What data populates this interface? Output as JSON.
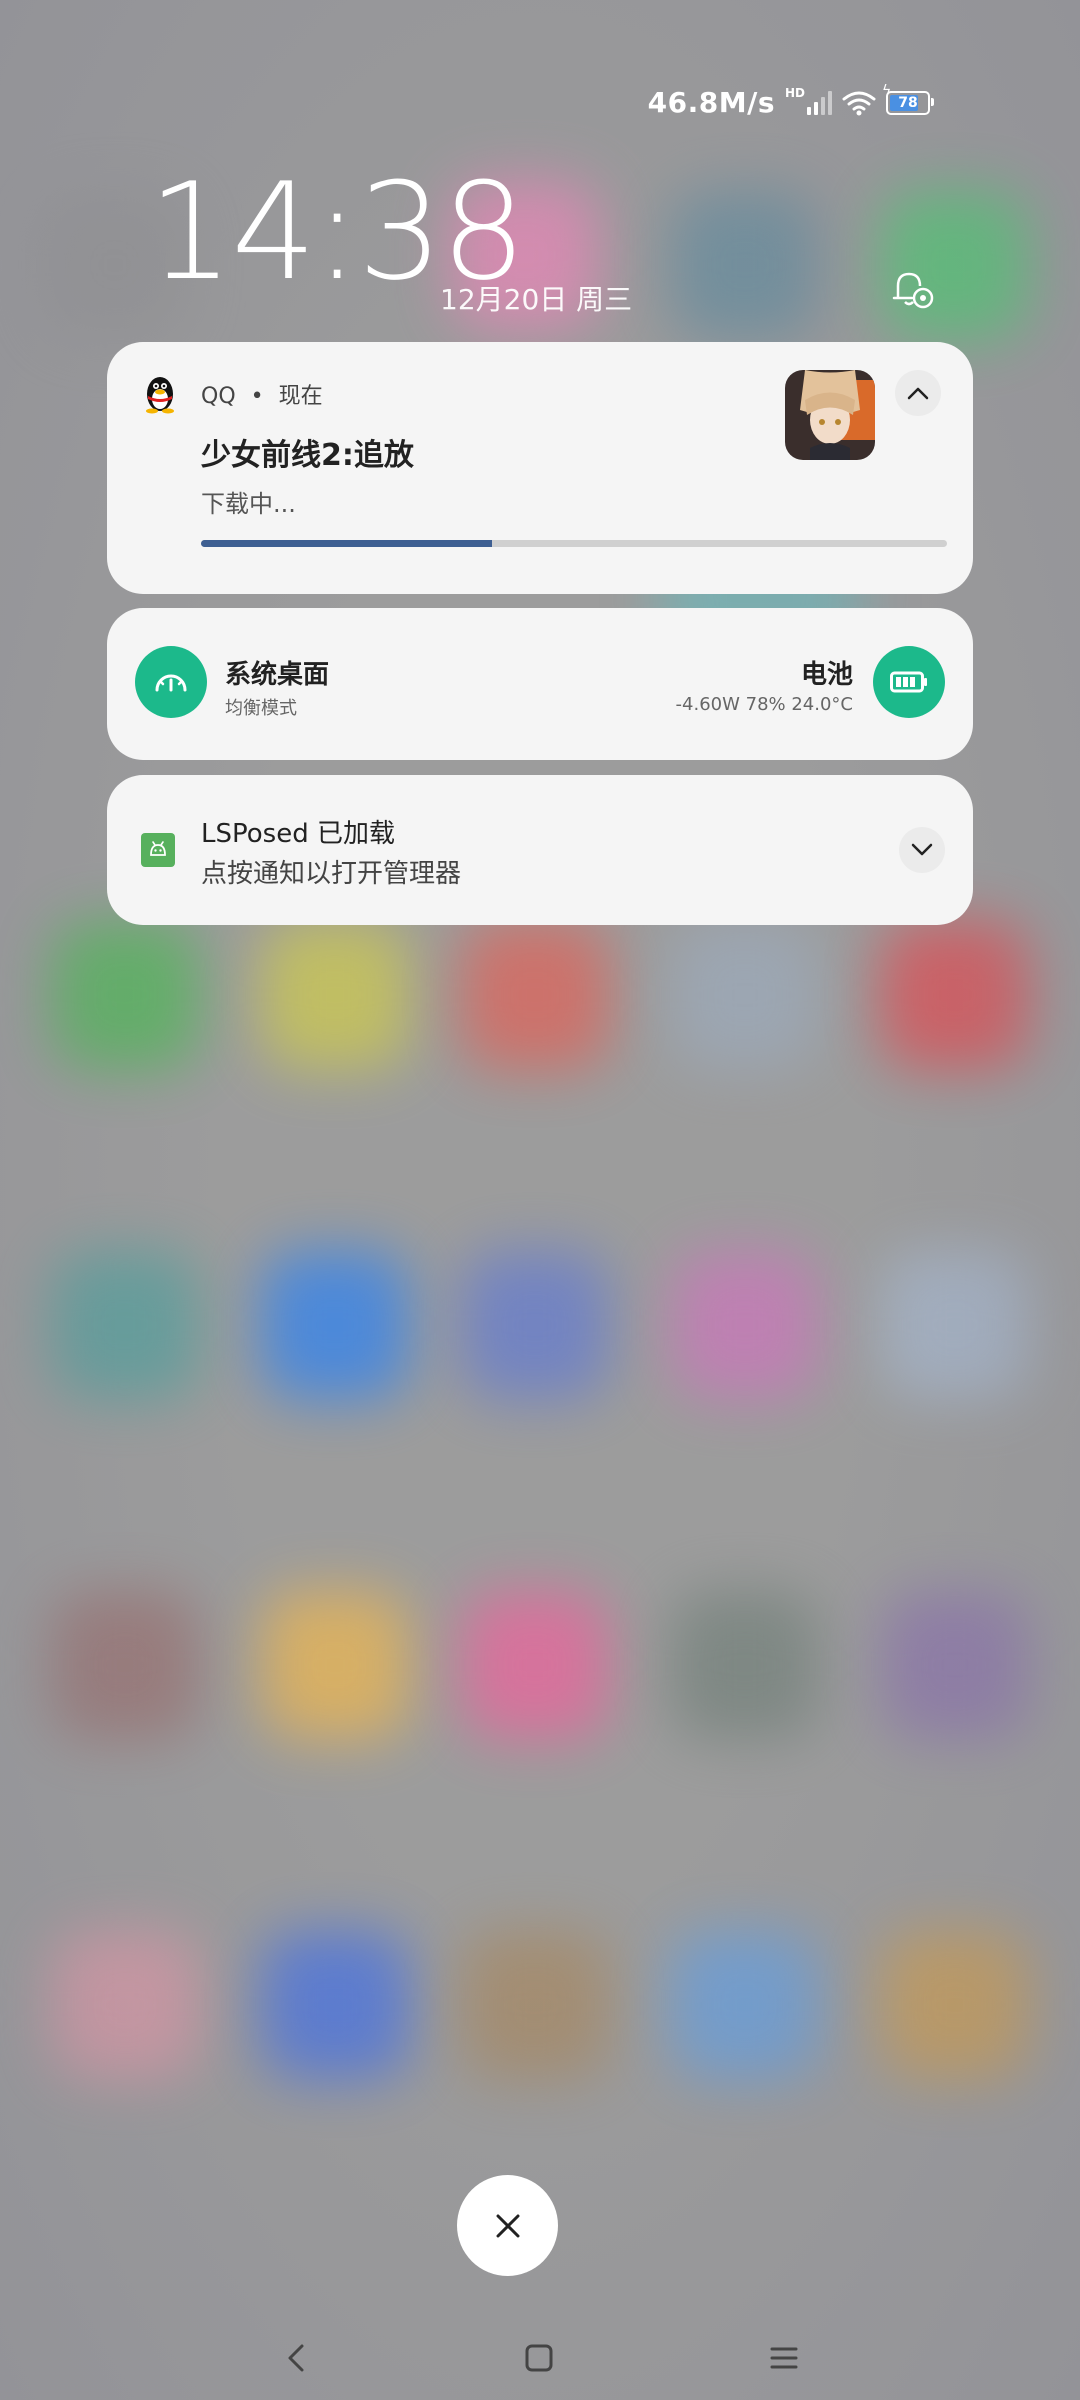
{
  "status_bar": {
    "net_speed": "46.8M/s",
    "net_speed_hd": "HD",
    "battery_level": "78",
    "battery_fraction": 0.78,
    "icons": [
      "signal-icon",
      "wifi-icon",
      "battery-charging-icon"
    ]
  },
  "lockscreen": {
    "time": "14:38",
    "date": "12月20日 周三"
  },
  "notifications": {
    "qq": {
      "app_name": "QQ",
      "separator": "•",
      "time": "现在",
      "title": "少女前线2:追放",
      "subtitle": "下载中...",
      "progress": 0.39
    },
    "battery_card": {
      "mode_title": "系统桌面",
      "mode_subtitle": "均衡模式",
      "battery_title": "电池",
      "battery_stats": "-4.60W 78% 24.0°C"
    },
    "lsposed": {
      "title": "LSPosed 已加载",
      "subtitle": "点按通知以打开管理器"
    }
  },
  "colors": {
    "accent_green": "#1cb98b",
    "progress_blue": "#3e5f92",
    "lsposed_green": "#57b05d"
  }
}
